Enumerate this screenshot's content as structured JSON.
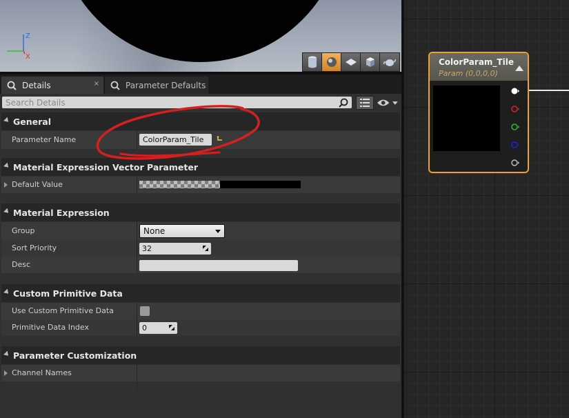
{
  "tabs": {
    "details_label": "Details",
    "details_close": "×",
    "param_defaults_label": "Parameter Defaults"
  },
  "search": {
    "placeholder": "Search Details"
  },
  "categories": {
    "general": "General",
    "vector_param": "Material Expression Vector Parameter",
    "material_expression": "Material Expression",
    "custom_primitive": "Custom Primitive Data",
    "param_customization": "Parameter Customization"
  },
  "properties": {
    "parameter_name": {
      "label": "Parameter Name",
      "value": "ColorParam_Tile"
    },
    "default_value": {
      "label": "Default Value",
      "color": "#000000"
    },
    "group": {
      "label": "Group",
      "value": "None"
    },
    "sort_priority": {
      "label": "Sort Priority",
      "value": "32"
    },
    "desc": {
      "label": "Desc",
      "value": ""
    },
    "use_custom_primitive": {
      "label": "Use Custom Primitive Data",
      "checked": false
    },
    "primitive_index": {
      "label": "Primitive Data Index",
      "value": "0"
    },
    "channel_names": {
      "label": "Channel Names"
    }
  },
  "gizmo": {
    "z": "Z",
    "x": "X"
  },
  "node": {
    "title": "ColorParam_Tile",
    "subtitle": "Param (0,0,0,0)",
    "border_color": "#f0a030",
    "pins": [
      "#ffffff",
      "#e02020",
      "#20c020",
      "#2020e0",
      "#bbbbbb"
    ]
  },
  "annotation_color": "#d42020"
}
